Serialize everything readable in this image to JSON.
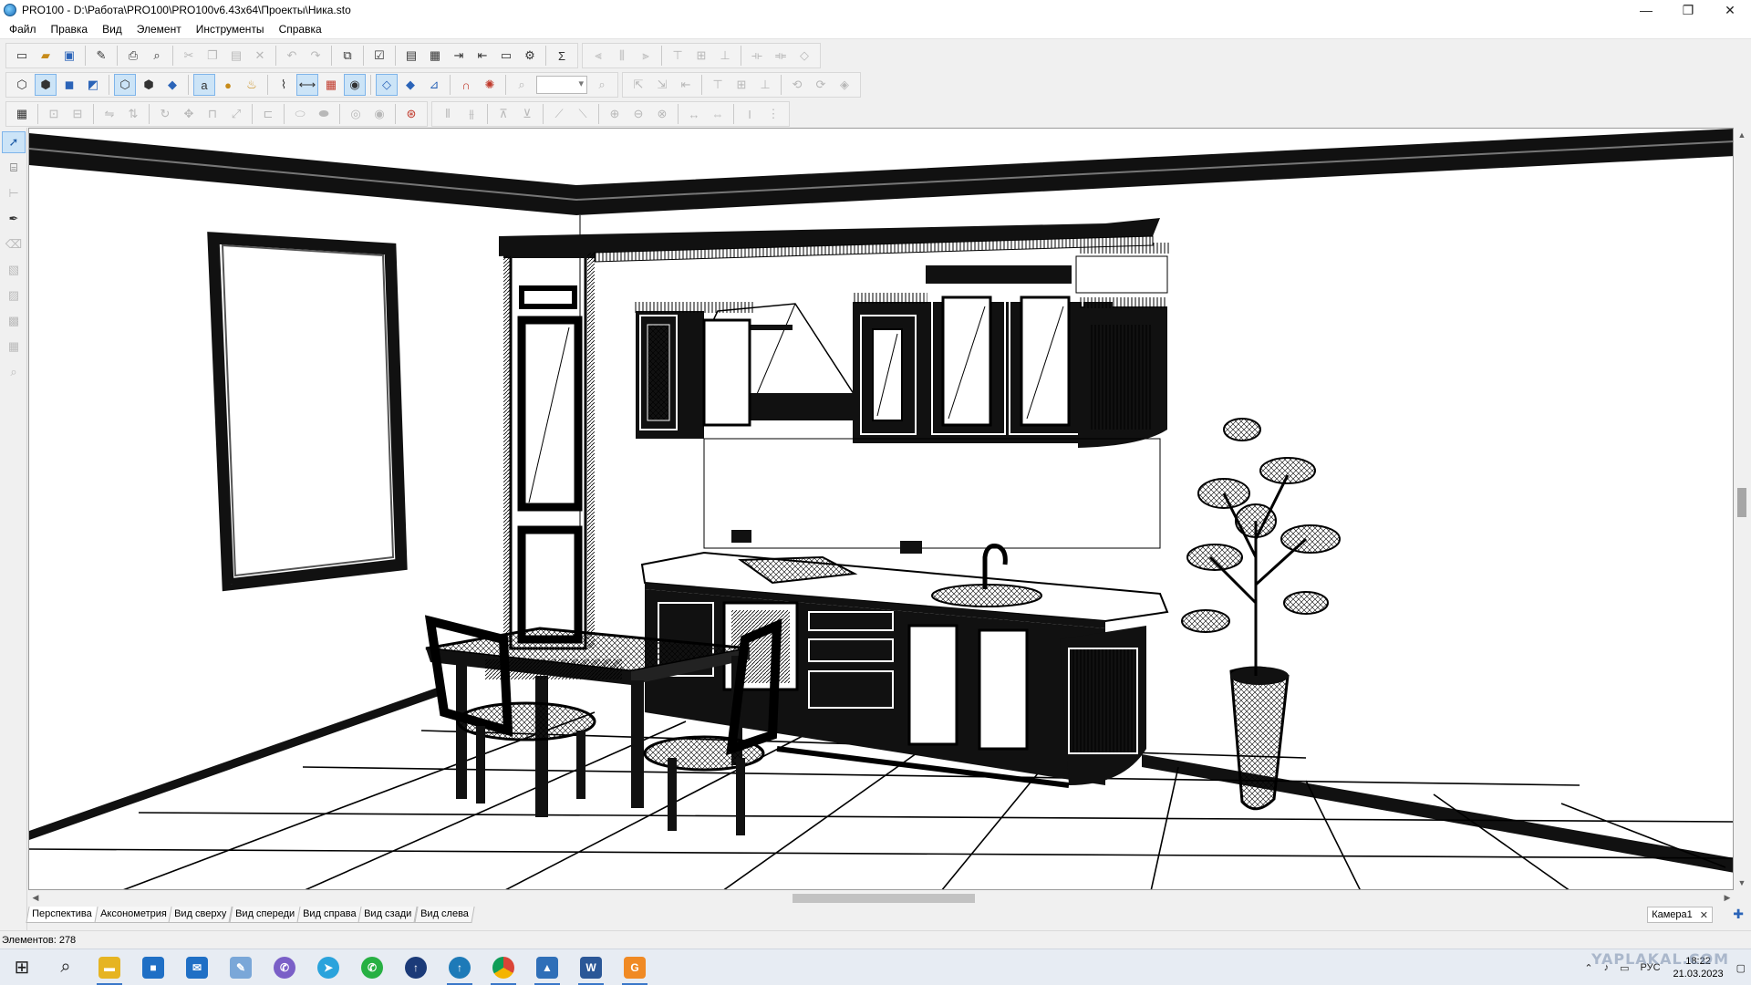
{
  "window": {
    "title": "PRO100 - D:\\Работа\\PRO100\\PRO100v6.43x64\\Проекты\\Ника.sto",
    "minimize": "—",
    "restore": "❐",
    "close": "✕"
  },
  "menu": [
    "Файл",
    "Правка",
    "Вид",
    "Элемент",
    "Инструменты",
    "Справка"
  ],
  "toolbar": {
    "row1_icons": [
      "new-file-icon",
      "open-folder-icon",
      "save-icon",
      "properties-icon",
      "print-icon",
      "print-preview-icon",
      "cut-icon",
      "copy-icon",
      "paste-icon",
      "delete-icon",
      "undo-icon",
      "redo-icon",
      "group-icon",
      "report-icon",
      "list-icon",
      "catalog-icon",
      "export-icon",
      "import-icon",
      "options-icon",
      "sum-icon"
    ],
    "sum_glyph": "Σ"
  },
  "view_tabs": [
    "Перспектива",
    "Аксонометрия",
    "Вид сверху",
    "Вид спереди",
    "Вид справа",
    "Вид сзади",
    "Вид слева"
  ],
  "camera_tab": {
    "label": "Камера1",
    "close": "✕",
    "add": "✚"
  },
  "status": {
    "elements": "Элементов: 278"
  },
  "taskbar": {
    "apps": [
      {
        "name": "start-button",
        "glyph": "⊞"
      },
      {
        "name": "search-button",
        "glyph": "⌕"
      },
      {
        "name": "file-explorer",
        "glyph": "▬",
        "color": "#e6b422"
      },
      {
        "name": "ms-store",
        "glyph": "■",
        "color": "#1f6fc5"
      },
      {
        "name": "mail",
        "glyph": "✉",
        "color": "#1f6fc5"
      },
      {
        "name": "paint",
        "glyph": "✎",
        "color": "#7aa7d8"
      },
      {
        "name": "viber",
        "glyph": "✆",
        "color": "#7a5fc7"
      },
      {
        "name": "telegram",
        "glyph": "➤",
        "color": "#2aa3dc"
      },
      {
        "name": "whatsapp",
        "glyph": "✆",
        "color": "#27b043"
      },
      {
        "name": "uploader",
        "glyph": "↑",
        "color": "#1b3a78"
      },
      {
        "name": "pro100",
        "glyph": "↑",
        "color": "#1d7ab8"
      },
      {
        "name": "chrome",
        "glyph": "●",
        "color": "#db4437"
      },
      {
        "name": "photos",
        "glyph": "▲",
        "color": "#2f6fb8"
      },
      {
        "name": "word",
        "glyph": "W",
        "color": "#2b5797"
      },
      {
        "name": "pdf-tool",
        "glyph": "G",
        "color": "#f08a24"
      }
    ],
    "tray": {
      "lang": "РУС",
      "time": "18:22",
      "date": "21.03.2023"
    },
    "watermark": "YAPLAKAL.COM"
  }
}
